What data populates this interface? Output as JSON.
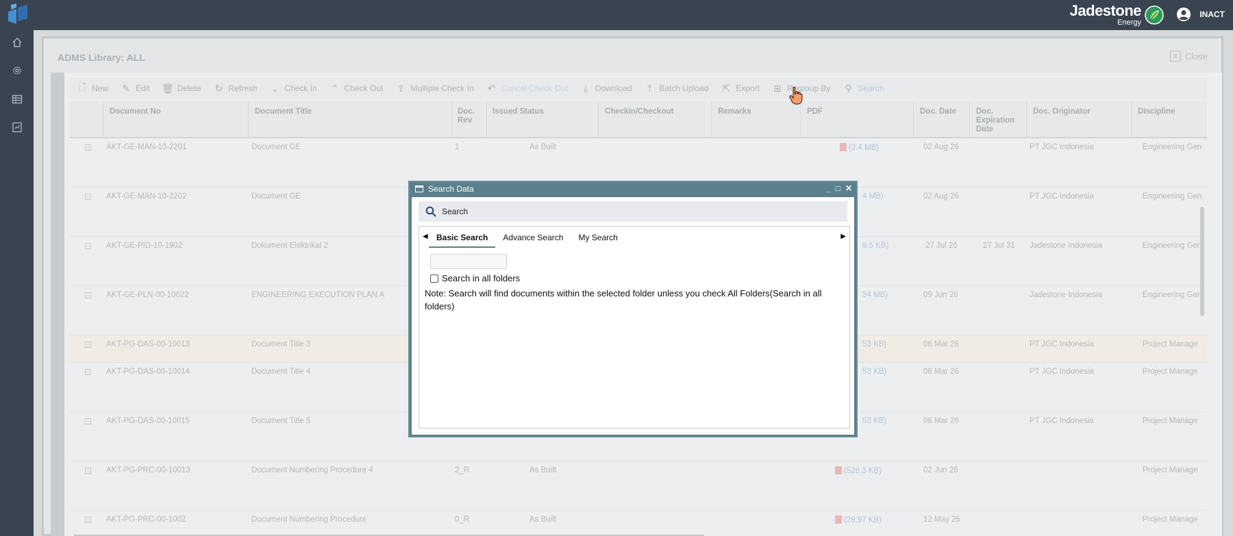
{
  "header": {
    "brand_name": "Jadestone",
    "brand_sub": "Energy",
    "user": "INACT"
  },
  "leftnav": {
    "icons": [
      "home-icon",
      "gear-icon",
      "grid-icon",
      "report-icon"
    ]
  },
  "panel": {
    "title": "ADMS Library: ALL",
    "close_label": "Close"
  },
  "toolbar": {
    "new": "New",
    "edit": "Edit",
    "delete": "Delete",
    "refresh": "Refresh",
    "check_in": "Check In",
    "check_out": "Check Out",
    "multiple_check_in": "Multiple Check In",
    "cancel_check_out": "Cancel Check Out",
    "download": "Download",
    "batch_upload": "Batch Upload",
    "export": "Export",
    "regroup_by": "Regroup By",
    "search": "Search"
  },
  "table": {
    "headers": {
      "doc_no": "Document No",
      "doc_title": "Document Title",
      "doc_rev_1": "Doc.",
      "doc_rev_2": "Rev",
      "issued_status": "Issued Status",
      "checkin": "Checkin/Checkout",
      "remarks": "Remarks",
      "pdf": "PDF",
      "doc_date": "Doc. Date",
      "exp_1": "Doc.",
      "exp_2": "Expiration",
      "exp_3": "Date",
      "originator": "Doc. Originator",
      "discipline": "Discipline"
    },
    "rows": [
      {
        "no": "AKT-GE-MAN-10-2201",
        "title": "Document GE",
        "rev": "1",
        "status": "As Built",
        "pdf": "(2.4 MB)",
        "date": "02 Aug 26",
        "exp": "",
        "orig": "PT JGC Indonesia",
        "disc": "Engineering Gen"
      },
      {
        "no": "AKT-GE-MAN-10-2202",
        "title": "Document GE",
        "rev": "",
        "status": "",
        "pdf": "4 MB)",
        "date": "02 Aug 26",
        "exp": "",
        "orig": "PT JGC Indonesia",
        "disc": "Engineering Gen"
      },
      {
        "no": "AKT-GE-PID-10-1902",
        "title": "Dokument Elektrikal 2",
        "rev": "",
        "status": "",
        "pdf": "8.5 KB)",
        "date": "27 Jul 26",
        "exp": "27 Jul 31",
        "orig": "Jadestone Indonesia",
        "disc": "Engineering Gen"
      },
      {
        "no": "AKT-GE-PLN-00-10022",
        "title": "ENGINEERING EXECUTION PLAN A",
        "rev": "",
        "status": "",
        "pdf": "34 MB)",
        "date": "09 Jun 26",
        "exp": "",
        "orig": "Jadestone Indonesia",
        "disc": "Engineering Gen"
      },
      {
        "no": "AKT-PG-DAS-00-10013",
        "title": "Document Title 3",
        "rev": "",
        "status": "",
        "pdf": "53 KB)",
        "date": "06 Mar 26",
        "exp": "",
        "orig": "PT JGC Indonesia",
        "disc": "Project Manage"
      },
      {
        "no": "AKT-PG-DAS-00-10014",
        "title": "Document Title 4",
        "rev": "",
        "status": "",
        "pdf": "53 KB)",
        "date": "06 Mar 26",
        "exp": "",
        "orig": "PT JGC Indonesia",
        "disc": "Project Manage"
      },
      {
        "no": "AKT-PG-DAS-00-10015",
        "title": "Document Title 5",
        "rev": "",
        "status": "",
        "pdf": "53 KB)",
        "date": "06 Mar 26",
        "exp": "",
        "orig": "PT JGC Indonesia",
        "disc": "Project Manage"
      },
      {
        "no": "AKT-PG-PRC-00-10013",
        "title": "Document Numbering Procedure 4",
        "rev": "2_R",
        "status": "As Built",
        "pdf": "(528.3 KB)",
        "date": "02 Jun 26",
        "exp": "",
        "orig": "",
        "disc": "Project Manage"
      },
      {
        "no": "AKT-PG-PRC-00-1002",
        "title": "Document Numbering Procedure",
        "rev": "0_R",
        "status": "As Built",
        "pdf": "(28.97 KB)",
        "date": "12 May 26",
        "exp": "",
        "orig": "",
        "disc": "Project Manage"
      }
    ]
  },
  "dialog": {
    "title": "Search Data",
    "search_label": "Search",
    "tabs": [
      "Basic Search",
      "Advance Search",
      "My Search"
    ],
    "active_tab": "Basic Search",
    "input_value": "",
    "checkbox_label": "Search in all folders",
    "note": "Note: Search will find documents within the selected folder unless you check All Folders(Search in all folders)"
  },
  "colors": {
    "topbar": "#3a4450",
    "dialog_frame": "#5b7f8c"
  }
}
